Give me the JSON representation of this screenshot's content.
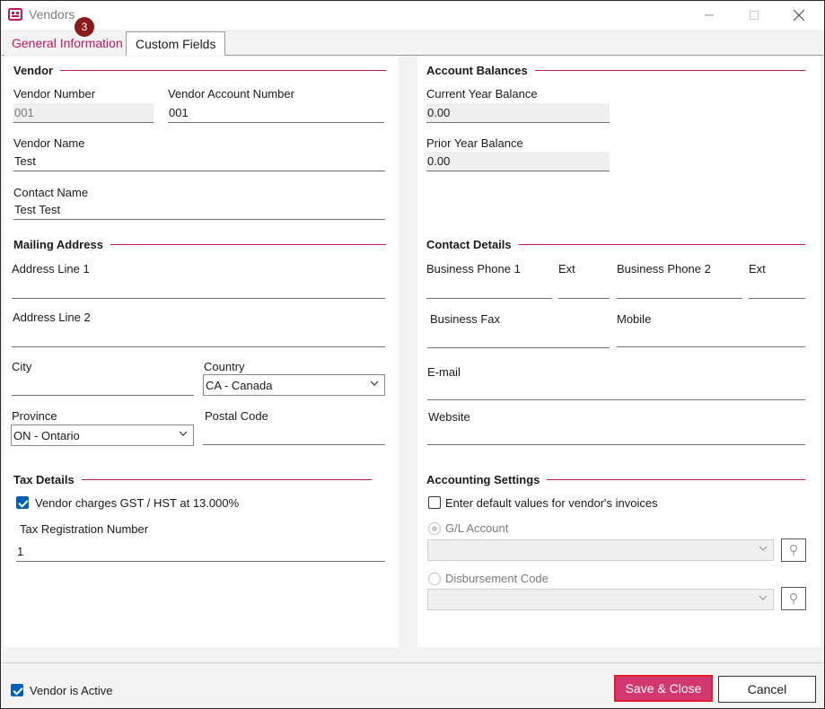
{
  "window": {
    "title": "Vendors"
  },
  "tabs": [
    {
      "label": "General Information",
      "badge": "3"
    },
    {
      "label": "Custom Fields"
    }
  ],
  "vendor": {
    "section_title": "Vendor",
    "vendor_number_label": "Vendor Number",
    "vendor_number_value": "001",
    "account_number_label": "Vendor Account Number",
    "account_number_value": "001",
    "name_label": "Vendor Name",
    "name_value": "Test",
    "contact_label": "Contact Name",
    "contact_value": "Test Test"
  },
  "mailing": {
    "section_title": "Mailing Address",
    "address1_label": "Address Line 1",
    "address1_value": "",
    "address2_label": "Address Line 2",
    "address2_value": "",
    "city_label": "City",
    "city_value": "",
    "country_label": "Country",
    "country_value": "CA - Canada",
    "province_label": "Province",
    "province_value": "ON - Ontario",
    "postal_label": "Postal Code",
    "postal_value": ""
  },
  "tax": {
    "section_title": "Tax Details",
    "gst_label": "Vendor charges GST / HST at 13.000%",
    "gst_checked": true,
    "registration_label": "Tax Registration Number",
    "registration_value": "1"
  },
  "balances": {
    "section_title": "Account Balances",
    "current_label": "Current Year Balance",
    "current_value": "0.00",
    "prior_label": "Prior Year Balance",
    "prior_value": "0.00"
  },
  "contact": {
    "section_title": "Contact Details",
    "phone1_label": "Business Phone 1",
    "ext1_label": "Ext",
    "phone2_label": "Business Phone 2",
    "ext2_label": "Ext",
    "fax_label": "Business Fax",
    "mobile_label": "Mobile",
    "email_label": "E-mail",
    "website_label": "Website"
  },
  "accounting": {
    "section_title": "Accounting Settings",
    "defaults_label": "Enter default values for vendor's invoices",
    "defaults_checked": false,
    "gl_label": "G/L Account",
    "disbursement_label": "Disbursement Code"
  },
  "footer": {
    "active_label": "Vendor is Active",
    "active_checked": true,
    "save_label": "Save & Close",
    "cancel_label": "Cancel"
  },
  "colors": {
    "accent": "#c2185b",
    "save_button": "#d0386f",
    "badge": "#8b1a1a",
    "checkbox": "#005fb8"
  },
  "icons": {
    "app": "vendors-app-icon",
    "minimize": "minimize-icon",
    "maximize": "maximize-icon",
    "close": "close-icon",
    "dropdown": "chevron-down-icon",
    "lookup": "lookup-pin-icon"
  }
}
